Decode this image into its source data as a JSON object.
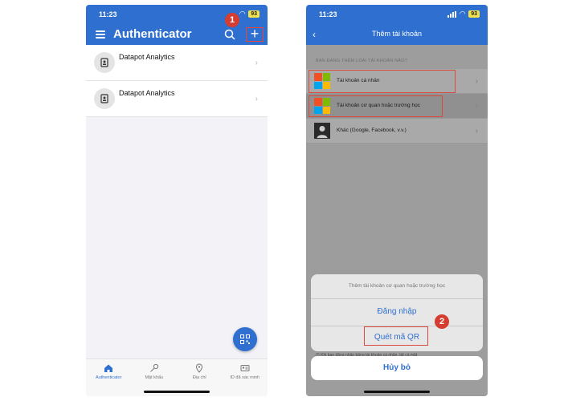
{
  "left": {
    "time": "11:23",
    "battery": "93",
    "title": "Authenticator",
    "step": "1",
    "accounts": [
      {
        "name": "Datapot Analytics"
      },
      {
        "name": "Datapot Analytics"
      }
    ],
    "tabs": [
      {
        "label": "Authenticator",
        "icon": "home-icon"
      },
      {
        "label": "Mật khẩu",
        "icon": "key-icon"
      },
      {
        "label": "Địa chỉ",
        "icon": "location-pin-icon"
      },
      {
        "label": "ID đã xác minh",
        "icon": "id-card-icon"
      }
    ],
    "accent": "#2f6fcf"
  },
  "right": {
    "time": "11:23",
    "battery": "93",
    "title": "Thêm tài khoản",
    "section": "BẠN ĐANG THÊM LOẠI TÀI KHOẢN NÀO?",
    "options": [
      {
        "label": "Tài khoản cá nhân",
        "icon": "microsoft-logo-icon"
      },
      {
        "label": "Tài khoản cơ quan hoặc trường học",
        "icon": "microsoft-logo-icon"
      },
      {
        "label": "Khác (Google, Facebook, v.v.)",
        "icon": "person-icon"
      }
    ],
    "sheet": {
      "title": "Thêm tài khoản cơ quan hoặc trường học",
      "signin": "Đăng nhập",
      "scan_qr": "Quét mã QR",
      "cancel": "Hủy bỏ"
    },
    "step": "2",
    "footnote": "(!) Khi bạn đăng nhập bằng tài khoản cá nhân, tất cả mật"
  }
}
